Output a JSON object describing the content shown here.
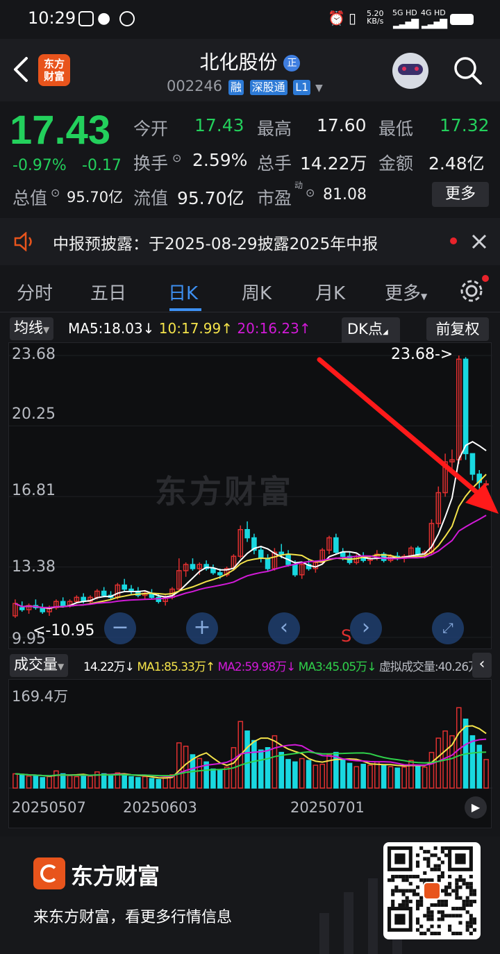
{
  "status": {
    "time": "10:29",
    "net_speed": "5.20\nKB/s",
    "sig1": "5G HD",
    "sig2": "4G HD"
  },
  "header": {
    "back_icon": "back-arrow-icon",
    "logo_text": "东方\n财富",
    "stock_name": "北化股份",
    "badge": "正",
    "code": "002246",
    "tags": [
      "融",
      "深股通",
      "L1"
    ]
  },
  "quote": {
    "price": "17.43",
    "pct": "-0.97%",
    "change": "-0.17",
    "open_label": "今开",
    "open": "17.43",
    "high_label": "最高",
    "high": "17.60",
    "low_label": "最低",
    "low": "17.32",
    "turnover_label": "换手",
    "turnover": "2.59%",
    "volume_label": "总手",
    "volume": "14.22万",
    "amount_label": "金额",
    "amount": "2.48亿",
    "mktcap_label": "总值",
    "mktcap": "95.70亿",
    "float_label": "流值",
    "float": "95.70亿",
    "pe_label": "市盈",
    "pe_sup": "动",
    "pe": "81.08",
    "more": "更多"
  },
  "notice": {
    "text": "中报预披露：于2025-08-29披露2025年中报"
  },
  "tabs": [
    "分时",
    "五日",
    "日K",
    "周K",
    "月K",
    "更多"
  ],
  "active_tab": 2,
  "indicator": {
    "ma_select": "均线",
    "ma5": "MA5:18.03",
    "ma5_arrow": "↓",
    "ma10": "10:17.99",
    "ma10_arrow": "↑",
    "ma20": "20:16.23",
    "ma20_arrow": "↑",
    "dk": "DK点",
    "adjust": "前复权"
  },
  "kchart_labels": {
    "y1": "23.68",
    "y2": "20.25",
    "y3": "16.81",
    "y4": "13.38",
    "y5": "9.95",
    "max_label": "23.68->",
    "min_label": "10.95",
    "s_mark": "S",
    "watermark": "东方财富"
  },
  "vol": {
    "select": "成交量",
    "v": "14.22万",
    "v_arrow": "↓",
    "ma1": "MA1:85.33万",
    "ma1_arrow": "↑",
    "ma2": "MA2:59.98万",
    "ma2_arrow": "↓",
    "ma3": "MA3:45.05万",
    "ma3_arrow": "↓",
    "virtual": "虚拟成交量:40.26万",
    "ymax": "169.4万"
  },
  "dates": [
    "20250507",
    "20250603",
    "20250701"
  ],
  "footer": {
    "brand": "东方财富",
    "slogan": "来东方财富，看更多行情信息"
  },
  "colors": {
    "up": "#e03030",
    "down": "#19d8e0",
    "ma5": "#ffffff",
    "ma10": "#f4e34a",
    "ma20": "#d21ad8",
    "accent": "#3d8ff0",
    "price_green": "#23d05c"
  },
  "chart_data": {
    "type": "candlestick",
    "ylim": [
      9.95,
      23.68
    ],
    "candles": [
      [
        11.0,
        11.8,
        10.9,
        11.6
      ],
      [
        11.4,
        11.7,
        11.2,
        11.3
      ],
      [
        11.3,
        11.6,
        11.1,
        11.5
      ],
      [
        11.5,
        11.8,
        11.3,
        11.4
      ],
      [
        11.4,
        11.6,
        11.1,
        11.2
      ],
      [
        11.2,
        11.5,
        11.0,
        11.4
      ],
      [
        11.4,
        11.8,
        11.3,
        11.7
      ],
      [
        11.7,
        11.9,
        11.4,
        11.5
      ],
      [
        11.5,
        11.8,
        11.4,
        11.7
      ],
      [
        11.7,
        12.0,
        11.6,
        11.9
      ],
      [
        11.9,
        12.1,
        11.6,
        11.7
      ],
      [
        11.7,
        12.0,
        11.6,
        11.9
      ],
      [
        11.9,
        12.3,
        11.8,
        12.2
      ],
      [
        12.2,
        12.4,
        11.9,
        12.0
      ],
      [
        12.0,
        12.2,
        11.8,
        11.9
      ],
      [
        11.9,
        12.6,
        11.8,
        12.5
      ],
      [
        12.5,
        12.8,
        12.2,
        12.3
      ],
      [
        12.3,
        12.5,
        12.0,
        12.2
      ],
      [
        12.2,
        12.4,
        11.9,
        12.0
      ],
      [
        12.0,
        12.2,
        11.8,
        12.1
      ],
      [
        12.1,
        12.3,
        11.8,
        11.9
      ],
      [
        11.9,
        12.1,
        11.6,
        11.7
      ],
      [
        11.7,
        12.0,
        11.5,
        11.9
      ],
      [
        11.9,
        12.4,
        11.8,
        12.3
      ],
      [
        12.3,
        13.8,
        12.2,
        13.2
      ],
      [
        13.2,
        13.6,
        12.9,
        13.5
      ],
      [
        13.5,
        13.8,
        13.2,
        13.3
      ],
      [
        13.3,
        13.6,
        13.0,
        13.5
      ],
      [
        13.5,
        13.7,
        13.2,
        13.3
      ],
      [
        13.3,
        13.5,
        13.0,
        13.1
      ],
      [
        13.1,
        13.3,
        12.8,
        13.0
      ],
      [
        13.0,
        13.4,
        12.9,
        13.3
      ],
      [
        13.3,
        14.0,
        13.2,
        13.9
      ],
      [
        13.9,
        15.4,
        13.8,
        15.2
      ],
      [
        15.2,
        15.6,
        14.6,
        14.8
      ],
      [
        14.8,
        15.0,
        14.0,
        14.2
      ],
      [
        14.2,
        14.4,
        13.6,
        13.8
      ],
      [
        13.8,
        14.0,
        13.2,
        13.3
      ],
      [
        13.3,
        14.3,
        13.2,
        14.1
      ],
      [
        14.1,
        14.5,
        13.8,
        14.0
      ],
      [
        14.0,
        14.2,
        13.4,
        13.5
      ],
      [
        13.5,
        13.7,
        12.9,
        13.0
      ],
      [
        13.0,
        13.6,
        12.8,
        13.5
      ],
      [
        13.5,
        13.8,
        13.2,
        13.3
      ],
      [
        13.3,
        13.7,
        13.1,
        13.6
      ],
      [
        13.6,
        14.3,
        13.5,
        14.2
      ],
      [
        14.2,
        14.9,
        14.0,
        14.8
      ],
      [
        14.8,
        15.0,
        14.0,
        14.1
      ],
      [
        14.1,
        14.3,
        13.7,
        13.9
      ],
      [
        13.9,
        14.1,
        13.5,
        13.6
      ],
      [
        13.6,
        14.0,
        13.5,
        13.9
      ],
      [
        13.9,
        14.1,
        13.6,
        13.7
      ],
      [
        13.7,
        13.9,
        13.5,
        13.8
      ],
      [
        13.8,
        14.2,
        13.7,
        14.0
      ],
      [
        14.0,
        14.1,
        13.6,
        13.7
      ],
      [
        13.7,
        14.0,
        13.6,
        13.9
      ],
      [
        13.9,
        14.1,
        13.7,
        13.8
      ],
      [
        13.8,
        14.0,
        13.6,
        13.9
      ],
      [
        13.9,
        14.4,
        13.8,
        14.3
      ],
      [
        14.3,
        14.4,
        13.9,
        14.0
      ],
      [
        14.0,
        14.2,
        13.8,
        14.1
      ],
      [
        14.1,
        15.7,
        14.0,
        15.5
      ],
      [
        15.5,
        17.3,
        15.3,
        17.0
      ],
      [
        17.0,
        18.9,
        16.8,
        18.5
      ],
      [
        18.5,
        19.1,
        18.0,
        18.6
      ],
      [
        18.6,
        23.68,
        18.4,
        23.5
      ],
      [
        23.5,
        23.6,
        18.6,
        18.9
      ],
      [
        18.9,
        18.9,
        17.6,
        17.9
      ],
      [
        17.9,
        18.1,
        17.2,
        17.5
      ],
      [
        17.43,
        17.6,
        17.32,
        17.43
      ]
    ],
    "ma5": [],
    "ma10": [],
    "ma20": [],
    "volume": [
      30,
      28,
      25,
      26,
      22,
      24,
      36,
      30,
      26,
      24,
      28,
      25,
      34,
      30,
      26,
      32,
      28,
      24,
      22,
      24,
      20,
      18,
      22,
      28,
      95,
      88,
      70,
      62,
      55,
      40,
      38,
      44,
      85,
      140,
      120,
      100,
      80,
      85,
      110,
      75,
      60,
      55,
      62,
      58,
      48,
      50,
      70,
      75,
      60,
      52,
      45,
      50,
      48,
      55,
      48,
      45,
      42,
      44,
      58,
      48,
      44,
      75,
      105,
      120,
      110,
      169,
      145,
      110,
      90,
      60
    ],
    "dates": [
      "20250507",
      "20250603",
      "20250701"
    ]
  }
}
